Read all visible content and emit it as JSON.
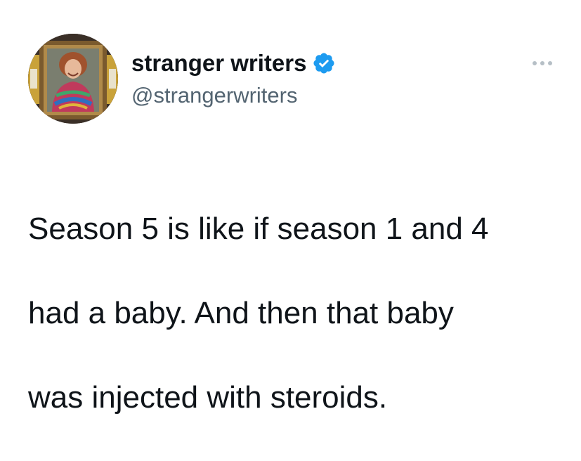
{
  "author": {
    "display_name": "stranger writers",
    "handle": "@strangerwriters",
    "verified": true,
    "avatar_icon": "framed-portrait-avatar",
    "verified_color": "#1d9bf0"
  },
  "tweet": {
    "lines": [
      "Season 5 is like if season 1 and 4",
      "had a baby. And then that baby",
      "was injected with steroids."
    ]
  },
  "menu": {
    "icon": "more-options-icon"
  },
  "colors": {
    "text": "#0f1419",
    "secondary": "#536471",
    "background": "#ffffff"
  }
}
